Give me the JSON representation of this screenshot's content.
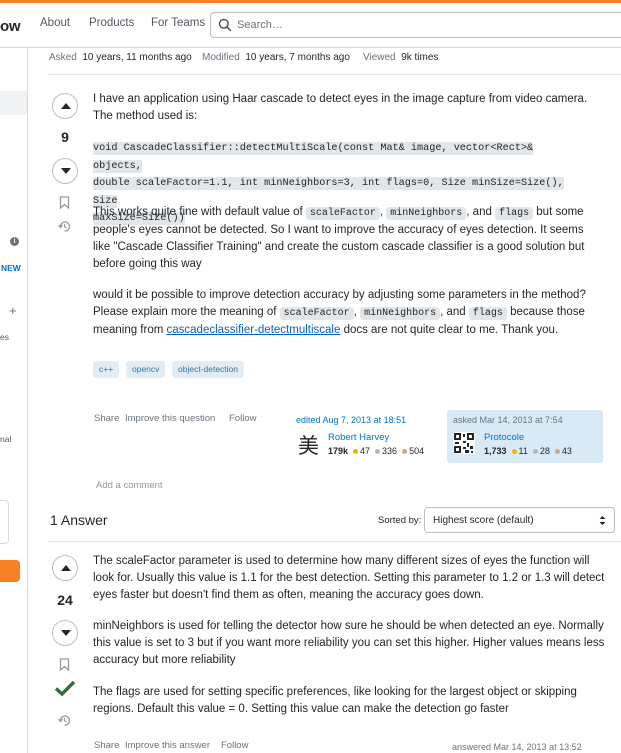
{
  "header": {
    "logo_text": "ow",
    "nav": [
      "About",
      "Products",
      "For Teams"
    ],
    "search_placeholder": "Search…"
  },
  "sidebar": {
    "new_badge": "NEW",
    "text_es": "es",
    "text_nal": "nal"
  },
  "question": {
    "meta": {
      "asked_label": "Asked",
      "asked_value": "10 years, 11 months ago",
      "modified_label": "Modified",
      "modified_value": "10 years, 7 months ago",
      "viewed_label": "Viewed",
      "viewed_value": "9k times"
    },
    "score": "9",
    "p1": "I have an application using Haar cascade to detect eyes in the image capture from video camera. The method used is:",
    "code_lines": [
      "void CascadeClassifier::detectMultiScale(const Mat& image, vector<Rect>& objects,",
      "double scaleFactor=1.1, int minNeighbors=3, int flags=0, Size minSize=Size(), Size",
      "maxSize=Size())"
    ],
    "p2_a": "This works quite fine with default value of ",
    "p2_code1": "scaleFactor",
    "p2_b": ", ",
    "p2_code2": "minNeighbors",
    "p2_c": ", and ",
    "p2_code3": "flags",
    "p2_d": " but some people's eyes cannot be detected. So I want to improve the accuracy of eyes detection. It seems like \"Cascade Classifier Training\" and create the custom cascade classifier is a good solution but before going this way",
    "p3_a": "would it be possible to improve detection accuracy by adjusting some parameters in the method? Please explain more the meaning of ",
    "p3_code1": "scaleFactor",
    "p3_b": ", ",
    "p3_code2": "minNeighbors",
    "p3_c": ", and ",
    "p3_code3": "flags",
    "p3_d": " because those meaning from ",
    "p3_link": "cascadeclassifier-detectmultiscale",
    "p3_e": " docs are not quite clear to me. Thank you.",
    "tags": [
      "c++",
      "opencv",
      "object-detection"
    ],
    "menu": [
      "Share",
      "Improve this question",
      "Follow"
    ],
    "edited": {
      "label": "edited Aug 7, 2013 at 18:51",
      "user": "Robert Harvey",
      "avatar_glyph": "美",
      "rep": "179k",
      "gold": "47",
      "silver": "336",
      "bronze": "504"
    },
    "asked": {
      "label": "asked Mar 14, 2013 at 7:54",
      "user": "Protocole",
      "rep": "1,733",
      "gold": "11",
      "silver": "28",
      "bronze": "43"
    },
    "add_comment": "Add a comment"
  },
  "answers_header": {
    "count_label": "1 Answer",
    "sort_label": "Sorted by:",
    "sort_value": "Highest score (default)"
  },
  "answer": {
    "score": "24",
    "p1": "The scaleFactor parameter is used to determine how many different sizes of eyes the function will look for. Usually this value is 1.1 for the best detection. Setting this parameter to 1.2 or 1.3 will detect eyes faster but doesn't find them as often, meaning the accuracy goes down.",
    "p2": "minNeighbors is used for telling the detector how sure he should be when detected an eye. Normally this value is set to 3 but if you want more reliability you can set this higher. Higher values means less accuracy but more reliability",
    "p3": "The flags are used for setting specific preferences, like looking for the largest object or skipping regions. Default this value = 0. Setting this value can make the detection go faster",
    "menu": [
      "Share",
      "Improve this answer",
      "Follow"
    ],
    "answered": "answered Mar 14, 2013 at 13:52"
  },
  "colors": {
    "accent": "#f48225",
    "link": "#0074cc",
    "accepted": "#2f6f44",
    "tag_bg": "#e1ecf4",
    "asked_card_bg": "#d9eaf7"
  }
}
